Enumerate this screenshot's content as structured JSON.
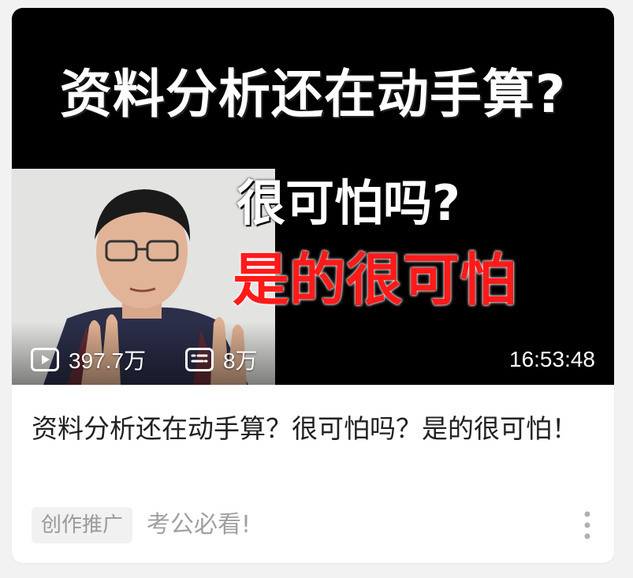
{
  "video": {
    "thumbnail": {
      "headline": "资料分析还在动手算?",
      "sub_line_1": "很可怕吗?",
      "sub_line_2": "是的很可怕"
    },
    "plays": "397.7万",
    "danmaku": "8万",
    "duration": "16:53:48",
    "title": "资料分析还在动手算？很可怕吗？是的很可怕！",
    "tag": "创作推广",
    "description": "考公必看!"
  },
  "icons": {
    "plays": "play-icon",
    "danmaku": "danmaku-icon",
    "more": "more-vertical-icon"
  },
  "colors": {
    "thumbnail_bg": "#000000",
    "highlight_red": "#ff1a1a",
    "title_text": "#212121",
    "muted_text": "#9a9a9a"
  }
}
